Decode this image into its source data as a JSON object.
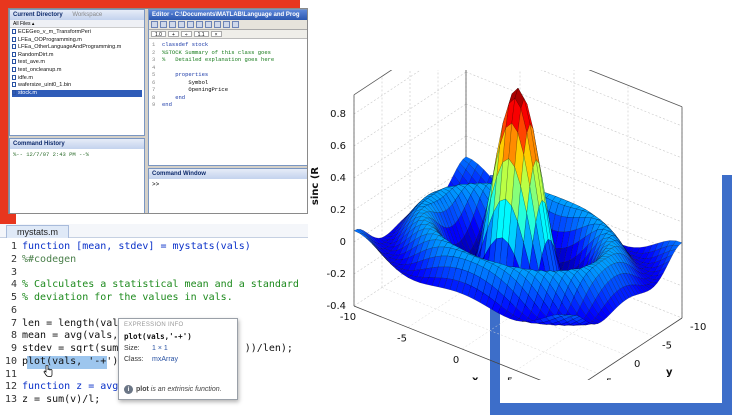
{
  "desktop": {
    "current_directory_title": "Current Directory",
    "workspace_tab": "Workspace",
    "all_files_header": "All Files ▴",
    "files": [
      "ECEGeo_v_m_TransformPeri",
      "LFEa_OOProgramming.m",
      "LFEa_OtherLanguageAndProgramming.m",
      "RandomDirt.m",
      "test_ave.m",
      "test_oncleanup.m",
      "idfe.m",
      "wafersize_uint0_1.bin",
      "stock.m"
    ],
    "selected_file_index": 8,
    "command_history_title": "Command History",
    "history_line": "%-- 12/7/07  2:43 PM --%",
    "editor_title": "Editor - C:\\Documents\\MATLAB\\Language and Prog",
    "editor_fields": [
      "1.0",
      "+",
      "÷",
      "1.1",
      "×"
    ],
    "editor_lines": [
      {
        "n": "1",
        "text": "classdef stock",
        "cls": "kw"
      },
      {
        "n": "2",
        "text": "%STOCK Summary of this class goes",
        "cls": "cm"
      },
      {
        "n": "3",
        "text": "%   Detailed explanation goes here",
        "cls": "cm"
      },
      {
        "n": "4",
        "text": "",
        "cls": ""
      },
      {
        "n": "5",
        "text": "    properties",
        "cls": "kw"
      },
      {
        "n": "6",
        "text": "        Symbol",
        "cls": ""
      },
      {
        "n": "7",
        "text": "        OpeningPrice",
        "cls": ""
      },
      {
        "n": "8",
        "text": "    end",
        "cls": "kw"
      },
      {
        "n": "9",
        "text": "end",
        "cls": "kw"
      }
    ],
    "command_window_title": "Command Window",
    "command_prompt": ">>"
  },
  "editor": {
    "tab_label": "mystats.m",
    "lines": [
      {
        "n": "1",
        "text": "function [mean, stdev] = mystats(vals)",
        "cls": "kw"
      },
      {
        "n": "2",
        "text": "%#codegen",
        "cls": "cm2"
      },
      {
        "n": "3",
        "text": "",
        "cls": ""
      },
      {
        "n": "4",
        "text": "% Calculates a statistical mean and a standard",
        "cls": "cm"
      },
      {
        "n": "5",
        "text": "% deviation for the values in vals.",
        "cls": "cm"
      },
      {
        "n": "6",
        "text": "",
        "cls": ""
      },
      {
        "n": "7",
        "text": "len = length(vals)",
        "cls": ""
      },
      {
        "n": "8",
        "text": "mean = avg(vals, l",
        "cls": ""
      },
      {
        "n": "9",
        "text": "stdev = sqrt(sum((                   ))/len);",
        "cls": ""
      },
      {
        "n": "10",
        "text": "plot(vals, '-+');",
        "cls": "hl"
      },
      {
        "n": "11",
        "text": "",
        "cls": ""
      },
      {
        "n": "12",
        "text": "function z = avg(v",
        "cls": "kw"
      },
      {
        "n": "13",
        "text": "z = sum(v)/l;",
        "cls": ""
      }
    ]
  },
  "tooltip": {
    "header": "EXPRESSION INFO",
    "signature": "plot(vals,'-+')",
    "size_label": "Size:",
    "size_value": "1 × 1",
    "class_label": "Class:",
    "class_value": "mxArray",
    "footer_bold": "plot",
    "footer_text": "is an extrinsic function."
  },
  "plot": {
    "zlabel": "sinc (R",
    "xlabel": "x",
    "ylabel": "y",
    "z_ticks": [
      "0.8",
      "0.6",
      "0.4",
      "0.2",
      "0",
      "-0.2",
      "-0.4"
    ],
    "y_ticks": [
      "5",
      "0",
      "-5",
      "-10"
    ],
    "x_ticks": [
      "-10",
      "-5",
      "0",
      "5",
      "10"
    ],
    "y_extra_tick": "10",
    "colormap": [
      "#00008f",
      "#0000ff",
      "#0080ff",
      "#00ffff",
      "#80ff80",
      "#ffff00",
      "#ff8000",
      "#ff0000",
      "#800000"
    ]
  },
  "colors": {
    "red_accent": "#e8361e",
    "blue_accent": "#3d6ec9"
  }
}
